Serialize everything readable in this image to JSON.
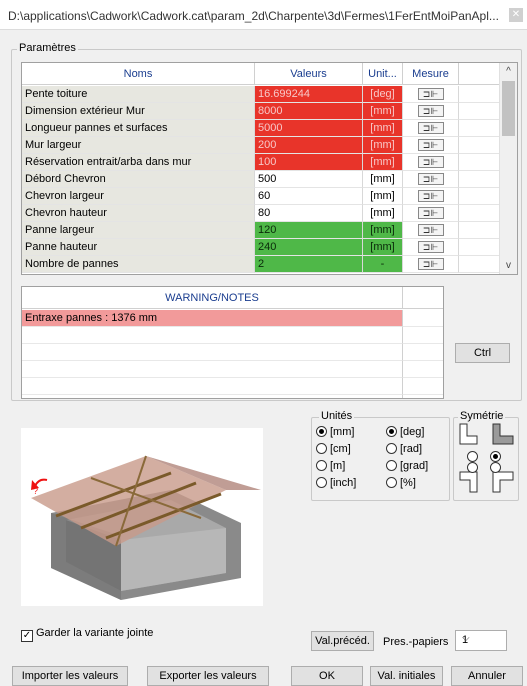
{
  "window": {
    "title": "D:\\applications\\Cadwork\\Cadwork.cat\\param_2d\\Charpente\\3d\\Fermes\\1FerEntMoiPanApl...",
    "close_glyph": "✕"
  },
  "parametres": {
    "label": "Paramètres",
    "headers": {
      "name": "Noms",
      "value": "Valeurs",
      "unit": "Unit...",
      "mesure": "Mesure"
    },
    "rows": [
      {
        "name": "Pente toiture",
        "value": "16.699244",
        "unit": "[deg]",
        "status": "red"
      },
      {
        "name": "Dimension extérieur Mur",
        "value": "8000",
        "unit": "[mm]",
        "status": "red"
      },
      {
        "name": "Longueur pannes et surfaces",
        "value": "5000",
        "unit": "[mm]",
        "status": "red"
      },
      {
        "name": "Mur largeur",
        "value": "200",
        "unit": "[mm]",
        "status": "red"
      },
      {
        "name": "Réservation entrait/arba dans mur",
        "value": "100",
        "unit": "[mm]",
        "status": "red"
      },
      {
        "name": "Débord Chevron",
        "value": "500",
        "unit": "[mm]",
        "status": "white"
      },
      {
        "name": "Chevron largeur",
        "value": "60",
        "unit": "[mm]",
        "status": "white"
      },
      {
        "name": "Chevron hauteur",
        "value": "80",
        "unit": "[mm]",
        "status": "white"
      },
      {
        "name": "Panne largeur",
        "value": "120",
        "unit": "[mm]",
        "status": "green"
      },
      {
        "name": "Panne hauteur",
        "value": "240",
        "unit": "[mm]",
        "status": "green"
      },
      {
        "name": "Nombre de pannes",
        "value": "2",
        "unit": "-",
        "status": "green"
      }
    ],
    "scroll_up": "^",
    "scroll_down": "v"
  },
  "warnings": {
    "header": "WARNING/NOTES",
    "rows": [
      "Entraxe pannes :  1376 mm",
      "",
      "",
      "",
      "",
      ""
    ]
  },
  "ctrl_button": "Ctrl",
  "units": {
    "label": "Unités",
    "length": [
      {
        "label": "[mm]",
        "selected": true
      },
      {
        "label": "[cm]",
        "selected": false
      },
      {
        "label": "[m]",
        "selected": false
      },
      {
        "label": "[inch]",
        "selected": false
      }
    ],
    "angle": [
      {
        "label": "[deg]",
        "selected": true
      },
      {
        "label": "[rad]",
        "selected": false
      },
      {
        "label": "[grad]",
        "selected": false
      },
      {
        "label": "[%]",
        "selected": false
      }
    ]
  },
  "symetrie": {
    "label": "Symétrie"
  },
  "garder_checkbox": {
    "label": "Garder la variante jointe",
    "checked": true,
    "glyph": "✓"
  },
  "val_preced_button": "Val.précéd.",
  "pres_papiers": {
    "label": "Pres.-papiers",
    "value": "1",
    "arrow": "⌵"
  },
  "footer_buttons": {
    "import": "Importer les valeurs",
    "export": "Exporter les valeurs",
    "ok": "OK",
    "initial": "Val. initiales",
    "cancel": "Annuler"
  },
  "colors": {
    "red": "#e8342a",
    "green": "#4fb848",
    "pink": "#f29a9a",
    "header_text": "#1a3d8f"
  }
}
